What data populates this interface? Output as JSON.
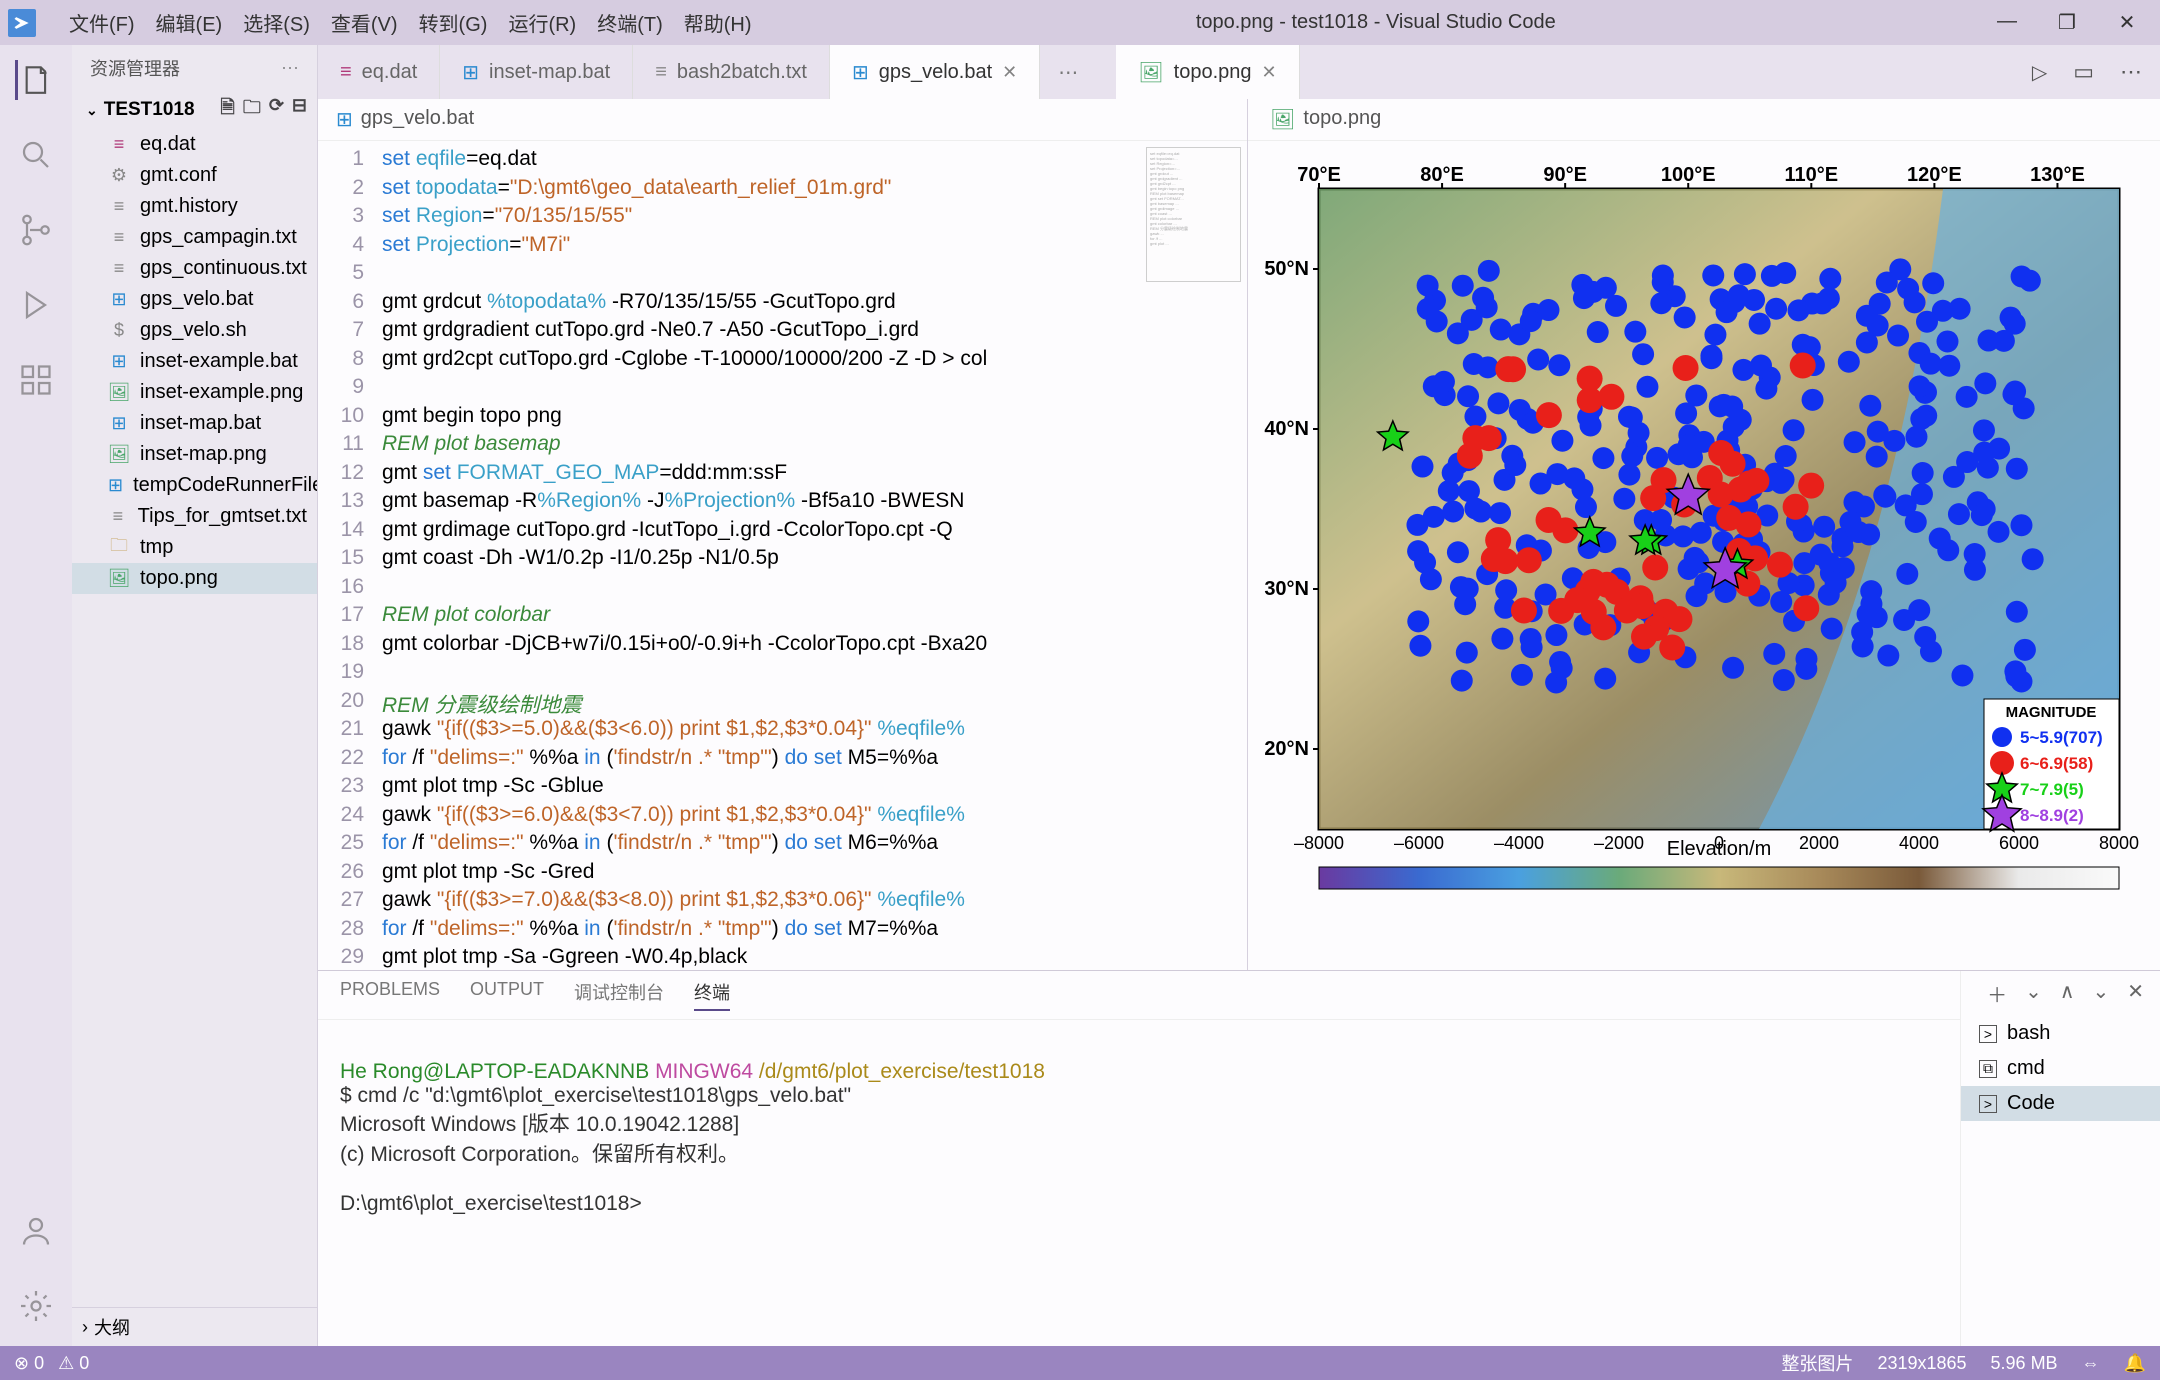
{
  "menus": [
    "文件(F)",
    "编辑(E)",
    "选择(S)",
    "查看(V)",
    "转到(G)",
    "运行(R)",
    "终端(T)",
    "帮助(H)"
  ],
  "window_title": "topo.png - test1018 - Visual Studio Code",
  "window_controls": [
    "—",
    "❐",
    "✕"
  ],
  "sidebar": {
    "title": "资源管理器",
    "project": "TEST1018",
    "files": [
      {
        "icon": "db",
        "label": "eq.dat"
      },
      {
        "icon": "gear",
        "label": "gmt.conf"
      },
      {
        "icon": "txt",
        "label": "gmt.history"
      },
      {
        "icon": "txt",
        "label": "gps_campagin.txt"
      },
      {
        "icon": "txt",
        "label": "gps_continuous.txt"
      },
      {
        "icon": "win",
        "label": "gps_velo.bat"
      },
      {
        "icon": "dollar",
        "label": "gps_velo.sh"
      },
      {
        "icon": "win",
        "label": "inset-example.bat"
      },
      {
        "icon": "img",
        "label": "inset-example.png"
      },
      {
        "icon": "win",
        "label": "inset-map.bat"
      },
      {
        "icon": "img",
        "label": "inset-map.png"
      },
      {
        "icon": "win",
        "label": "tempCodeRunnerFile..."
      },
      {
        "icon": "txt",
        "label": "Tips_for_gmtset.txt"
      },
      {
        "icon": "folder",
        "label": "tmp"
      },
      {
        "icon": "img",
        "label": "topo.png",
        "selected": true
      }
    ],
    "outline": "大纲"
  },
  "left_tabs": [
    {
      "label": "eq.dat",
      "icon": "db"
    },
    {
      "label": "inset-map.bat",
      "icon": "win"
    },
    {
      "label": "bash2batch.txt",
      "icon": "txt"
    },
    {
      "label": "gps_velo.bat",
      "icon": "win",
      "active": true,
      "closeable": true
    }
  ],
  "left_tabs_dots": "⋯",
  "right_tabs": [
    {
      "label": "topo.png",
      "icon": "img",
      "active": true,
      "closeable": true
    }
  ],
  "right_tab_icons": [
    "▷",
    "▭",
    "⋯"
  ],
  "breadcrumb_left": {
    "icon": "win",
    "label": "gps_velo.bat"
  },
  "breadcrumb_right": {
    "icon": "img",
    "label": "topo.png"
  },
  "gutter_lines": 30,
  "panel": {
    "tabs": [
      "PROBLEMS",
      "OUTPUT",
      "调试控制台",
      "终端"
    ],
    "active_tab": "终端",
    "terminals": [
      {
        "icon": ">",
        "label": "bash"
      },
      {
        "icon": "⧉",
        "label": "cmd"
      },
      {
        "icon": ">",
        "label": "Code",
        "selected": true
      }
    ],
    "hdr_icons": [
      "＋",
      "⌄",
      "∧",
      "⌄",
      "✕"
    ]
  },
  "terminal_lines": {
    "prompt_user": "He Rong@LAPTOP-EADAKNNB",
    "prompt_host": "MINGW64",
    "prompt_path": "/d/gmt6/plot_exercise/test1018",
    "cmd": "$ cmd /c \"d:\\gmt6\\plot_exercise\\test1018\\gps_velo.bat\"",
    "winver": "Microsoft Windows [版本 10.0.19042.1288]",
    "copyright": "(c) Microsoft Corporation。保留所有权利。",
    "cwd": "D:\\gmt6\\plot_exercise\\test1018>"
  },
  "statusbar": {
    "left": [
      "⊗ 0",
      "⚠ 0"
    ],
    "right": [
      "整张图片",
      "2319x1865",
      "5.96 MB",
      "⇔",
      "🔔"
    ]
  },
  "chart_data": {
    "type": "map-scatter",
    "title": "",
    "xlabel_ticks": [
      "70°E",
      "80°E",
      "90°E",
      "100°E",
      "110°E",
      "120°E",
      "130°E"
    ],
    "ylabel_ticks": [
      "20°N",
      "30°N",
      "40°N",
      "50°N"
    ],
    "xlim": [
      70,
      135
    ],
    "ylim": [
      15,
      55
    ],
    "colorbar": {
      "label": "Elevation/m",
      "min": -8000,
      "max": 8000,
      "ticks": [
        -8000,
        -6000,
        -4000,
        -2000,
        0,
        2000,
        4000,
        6000,
        8000
      ]
    },
    "legend": {
      "title": "MAGNITUDE",
      "entries": [
        {
          "symbol": "circle",
          "color": "#1030f0",
          "size": 10,
          "label": "5~5.9(707)"
        },
        {
          "symbol": "circle",
          "color": "#e8201a",
          "size": 12,
          "label": "6~6.9(58)"
        },
        {
          "symbol": "star",
          "color": "#18d018",
          "outline": "#000",
          "size": 16,
          "label": "7~7.9(5)"
        },
        {
          "symbol": "star",
          "color": "#a040e0",
          "outline": "#000",
          "size": 20,
          "label": "8~8.9(2)"
        }
      ]
    },
    "series": [
      {
        "name": "M5-5.9",
        "symbol": "circle",
        "color": "#1030f0",
        "count": 707
      },
      {
        "name": "M6-6.9",
        "symbol": "circle",
        "color": "#e8201a",
        "count": 58
      },
      {
        "name": "M7-7.9",
        "symbol": "star",
        "color": "#18d018",
        "count": 5,
        "points": [
          [
            76,
            39.5
          ],
          [
            92,
            33.5
          ],
          [
            97,
            33
          ],
          [
            96.5,
            33
          ],
          [
            104,
            31.5
          ]
        ]
      },
      {
        "name": "M8-8.9",
        "symbol": "star",
        "color": "#a040e0",
        "count": 2,
        "points": [
          [
            100,
            35.8
          ],
          [
            103,
            31.2
          ]
        ]
      }
    ],
    "note": "blue/red points densely cover lon 76–130, lat 22–50; individual coordinates estimated, not all enumerated"
  }
}
